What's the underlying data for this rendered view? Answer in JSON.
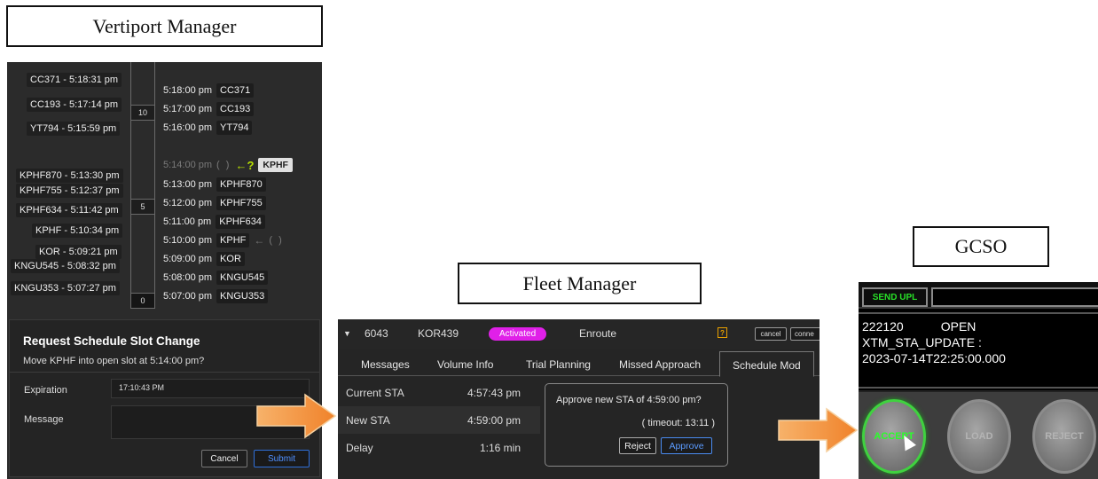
{
  "captions": {
    "vertiport": "Vertiport Manager",
    "fleet": "Fleet Manager",
    "gcso": "GCSO"
  },
  "vertiport": {
    "arrivals": [
      {
        "label": "CC371 - 5:18:31 pm"
      },
      {
        "label": "CC193 - 5:17:14 pm"
      },
      {
        "label": "YT794 - 5:15:59 pm"
      },
      {
        "label": "KPHF870 - 5:13:30 pm"
      },
      {
        "label": "KPHF755 - 5:12:37 pm"
      },
      {
        "label": "KPHF634 - 5:11:42 pm"
      },
      {
        "label": "KPHF - 5:10:34 pm"
      },
      {
        "label": "KOR - 5:09:21 pm"
      },
      {
        "label": "KNGU545 - 5:08:32 pm"
      },
      {
        "label": "KNGU353 - 5:07:27 pm"
      }
    ],
    "tape_marks": [
      "10",
      "5",
      "0"
    ],
    "slots": [
      {
        "time": "5:18:00 pm",
        "id": "CC371"
      },
      {
        "time": "5:17:00 pm",
        "id": "CC193"
      },
      {
        "time": "5:16:00 pm",
        "id": "YT794"
      },
      {
        "time": "5:13:00 pm",
        "id": "KPHF870"
      },
      {
        "time": "5:12:00 pm",
        "id": "KPHF755"
      },
      {
        "time": "5:11:00 pm",
        "id": "KPHF634"
      },
      {
        "time": "5:09:00 pm",
        "id": "KOR"
      },
      {
        "time": "5:08:00 pm",
        "id": "KNGU545"
      },
      {
        "time": "5:07:00 pm",
        "id": "KNGU353"
      }
    ],
    "open_slot": {
      "time": "5:14:00 pm",
      "paren": "(        )",
      "arrow": "←?",
      "badge": "KPHF"
    },
    "requesting_slot": {
      "time": "5:10:00 pm",
      "id": "KPHF",
      "arrow": "←",
      "paren": "(        )"
    },
    "dialog": {
      "title": "Request Schedule Slot Change",
      "question": "Move KPHF into open slot at 5:14:00 pm?",
      "expiration_label": "Expiration",
      "expiration_value": "17:10:43 PM",
      "message_label": "Message",
      "message_value": "",
      "cancel_label": "Cancel",
      "submit_label": "Submit"
    }
  },
  "fleet": {
    "header": {
      "chevron": "▼",
      "flight_num": "6043",
      "callsign": "KOR439",
      "status": "Activated",
      "phase": "Enroute",
      "warn": "?",
      "cancel_label": "cancel",
      "connect_label": "conne"
    },
    "tabs": [
      "Messages",
      "Volume Info",
      "Trial Planning",
      "Missed Approach",
      "Schedule Mod"
    ],
    "rows": [
      {
        "label": "Current STA",
        "value": "4:57:43 pm"
      },
      {
        "label": "New STA",
        "value": "4:59:00 pm"
      },
      {
        "label": "Delay",
        "value": "1:16 min"
      }
    ],
    "popup": {
      "question": "Approve new STA of 4:59:00 pm?",
      "timeout": "( timeout: 13:11 )",
      "reject_label": "Reject",
      "approve_label": "Approve"
    }
  },
  "gcso": {
    "send_label": "SEND UPL",
    "message_line1_a": "222120",
    "message_line1_b": "OPEN",
    "message_line2": "XTM_STA_UPDATE :",
    "message_line3": "2023-07-14T22:25:00.000",
    "accept_label": "ACCEPT",
    "load_label": "LOAD",
    "reject_label": "REJECT"
  },
  "colors": {
    "arrow_orange": "#f0882a",
    "accept_green": "#2aff2a",
    "activated_magenta": "#e020e8",
    "submit_blue": "#2f6fd8"
  }
}
